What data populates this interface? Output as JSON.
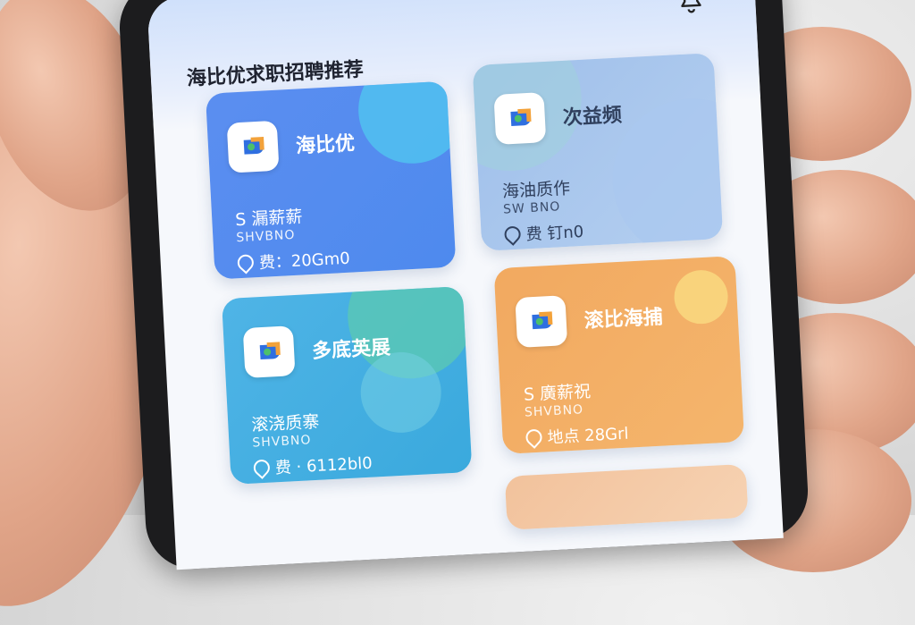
{
  "screen_title": "海比优求职招聘推荐",
  "cards": [
    {
      "name": "海比优",
      "line1": "S 漏薪薪",
      "line2": "SHVBNO",
      "line3": "费：20Gm0"
    },
    {
      "name": "次益频",
      "line1": "海油质作",
      "line2": "SW BNO",
      "line3": "费    钉n0"
    },
    {
      "name": "多底英展",
      "line1": "滚浇质寨",
      "line2": "SHVBNO",
      "line3": "费 · 6112bl0"
    },
    {
      "name": "滚比海捕",
      "line1": "S 廣薪祝",
      "line2": "SHVBNO",
      "line3": "地点 28Grl"
    }
  ],
  "icons": [
    "bell-icon",
    "app-logo-icon",
    "location-pin-icon"
  ],
  "colors": {
    "card_blue": "#4e8aee",
    "card_lightblue": "#b4cff0",
    "card_cyan": "#3aa9dd",
    "card_orange": "#f2a960"
  }
}
